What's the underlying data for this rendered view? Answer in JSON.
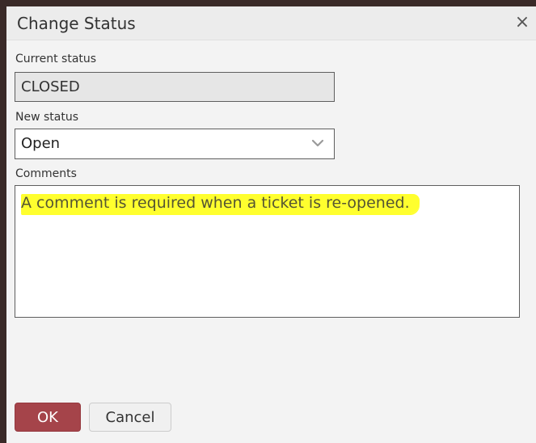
{
  "dialog": {
    "title": "Change Status",
    "close_glyph": "×",
    "close_icon": "close-icon"
  },
  "current_status": {
    "label": "Current status",
    "value": "CLOSED"
  },
  "new_status": {
    "label": "New status",
    "value": "Open",
    "icon": "chevron-down-icon"
  },
  "comments": {
    "label": "Comments",
    "value": "A comment is required when a ticket is re-opened.",
    "highlight_color": "#ffff2e"
  },
  "buttons": {
    "ok_label": "OK",
    "cancel_label": "Cancel",
    "ok_color": "#a5444a"
  }
}
